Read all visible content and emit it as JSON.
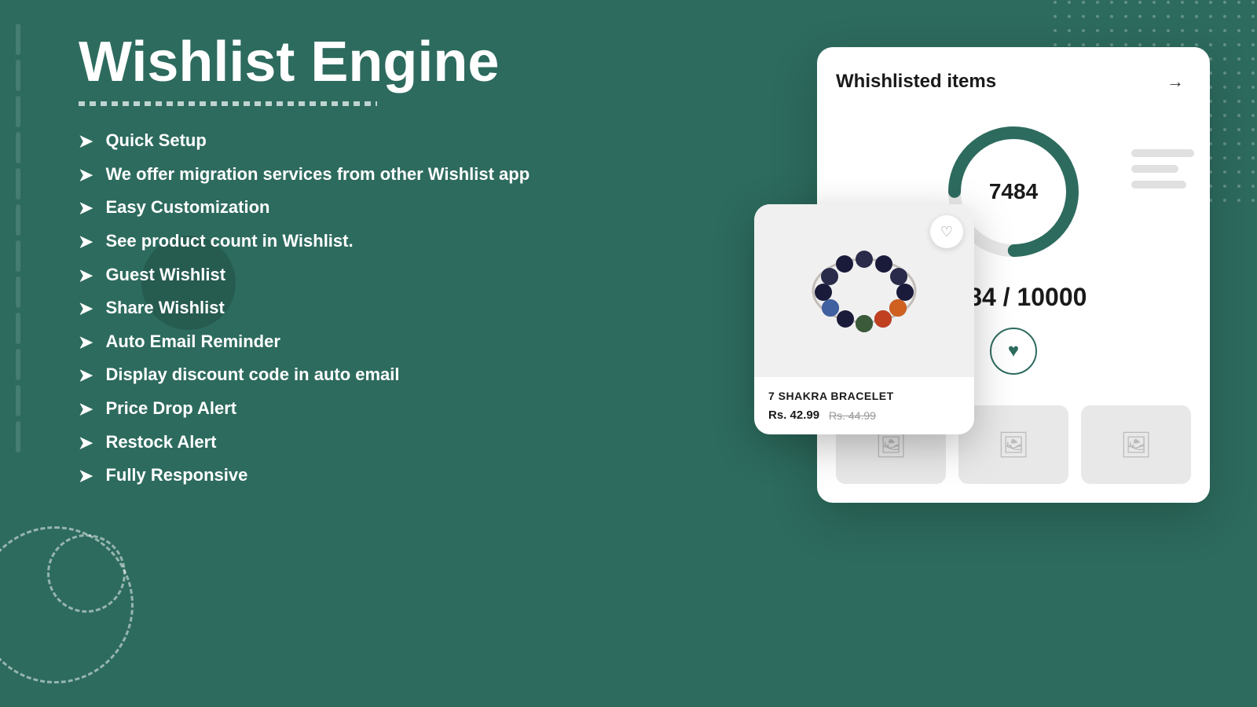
{
  "page": {
    "title": "Wishlist Engine",
    "background_color": "#2d6b5e"
  },
  "features": {
    "items": [
      {
        "id": 1,
        "text": "Quick Setup"
      },
      {
        "id": 2,
        "text": "We offer migration services from other Wishlist app"
      },
      {
        "id": 3,
        "text": "Easy Customization"
      },
      {
        "id": 4,
        "text": "See product count in Wishlist."
      },
      {
        "id": 5,
        "text": "Guest Wishlist"
      },
      {
        "id": 6,
        "text": "Share Wishlist"
      },
      {
        "id": 7,
        "text": "Auto Email Reminder"
      },
      {
        "id": 8,
        "text": "Display discount code in auto email"
      },
      {
        "id": 9,
        "text": "Price Drop Alert"
      },
      {
        "id": 10,
        "text": "Restock Alert"
      },
      {
        "id": 11,
        "text": "Fully Responsive"
      }
    ],
    "arrow_symbol": "➤"
  },
  "wishlist_panel": {
    "title": "Whishlisted items",
    "count": 7484,
    "count_display": "7484",
    "count_ratio": "7484 / 10000",
    "arrow_label": "→",
    "accent_color": "#2d6b5e",
    "donut_value": 7484,
    "donut_max": 10000
  },
  "product_card": {
    "name": "7 SHAKRA BRACELET",
    "price_current": "Rs. 42.99",
    "price_original": "Rs. 44.99",
    "heart_icon": "♡"
  },
  "heart_icon_label": "♥",
  "image_placeholder": "🖼"
}
